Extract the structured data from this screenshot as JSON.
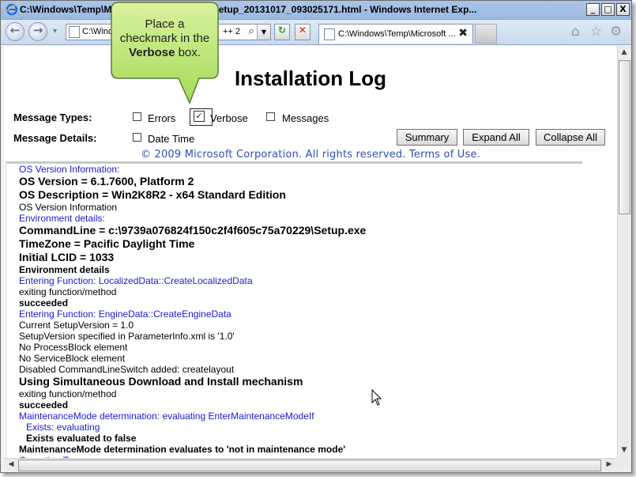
{
  "window": {
    "title": "C:\\Windows\\Temp\\M... x86 Redistributable Setup_20131017_093025171.html - Windows Internet Exp...",
    "minimize": "_",
    "maximize": "□",
    "close": "X"
  },
  "toolbar": {
    "back": "←",
    "forward": "→",
    "dropdown": "▾",
    "address": "C:\\Windo",
    "address_tail": "++ 2",
    "search_glyph": "⌕",
    "refresh": "↻",
    "stop": "✕",
    "tab_label": "C:\\Windows\\Temp\\Microsoft ...",
    "tab_close": "✖",
    "home": "⌂",
    "favorites": "☆",
    "tools": "⚙"
  },
  "callout": {
    "line1": "Place a",
    "line2": "checkmark in the",
    "bold": "Verbose",
    "line3_tail": " box."
  },
  "page": {
    "title": "Installation Log",
    "message_types_label": "Message Types:",
    "message_details_label": "Message Details:",
    "options": {
      "errors": "Errors",
      "verbose": "Verbose",
      "messages": "Messages",
      "date_time": "Date Time"
    },
    "verbose_checked": true,
    "buttons": {
      "summary": "Summary",
      "expand_all": "Expand All",
      "collapse_all": "Collapse All"
    },
    "copyright": "© 2009 Microsoft Corporation. All rights reserved. Terms of Use."
  },
  "log": [
    {
      "text": "OS Version Information:",
      "style": "s blue"
    },
    {
      "text": "OS Version = 6.1.7600, Platform 2",
      "style": "l"
    },
    {
      "text": "OS Description = Win2K8R2 - x64 Standard Edition",
      "style": "l"
    },
    {
      "text": "OS Version Information",
      "style": "s"
    },
    {
      "text": "Environment details:",
      "style": "s blue"
    },
    {
      "text": "CommandLine = c:\\9739a076824f150c2f4f605c75a70229\\Setup.exe",
      "style": "l"
    },
    {
      "text": "TimeZone = Pacific Daylight Time",
      "style": "l"
    },
    {
      "text": "Initial LCID = 1033",
      "style": "l"
    },
    {
      "text": "Environment details",
      "style": "m"
    },
    {
      "text": "Entering Function: LocalizedData::CreateLocalizedData",
      "style": "s blue"
    },
    {
      "text": "exiting function/method",
      "style": "s"
    },
    {
      "text": "succeeded",
      "style": "m"
    },
    {
      "text": "Entering Function: EngineData::CreateEngineData",
      "style": "s blue"
    },
    {
      "text": "Current SetupVersion = 1.0",
      "style": "s"
    },
    {
      "text": "SetupVersion specified in ParameterInfo.xml is '1.0'",
      "style": "s"
    },
    {
      "text": "No ProcessBlock element",
      "style": "s"
    },
    {
      "text": "No ServiceBlock element",
      "style": "s"
    },
    {
      "text": "Disabled CommandLineSwitch added: createlayout",
      "style": "s"
    },
    {
      "text": "Using Simultaneous Download and Install mechanism",
      "style": "l"
    },
    {
      "text": "exiting function/method",
      "style": "s"
    },
    {
      "text": "succeeded",
      "style": "m"
    },
    {
      "text": "MaintenanceMode determination: evaluating EnterMaintenanceModeIf",
      "style": "s blue"
    },
    {
      "text": "Exists: evaluating",
      "style": "s blue indent"
    },
    {
      "text": "Exists evaluated to false",
      "style": "m indent"
    },
    {
      "text": "MaintenanceMode determination evaluates to 'not in maintenance mode'",
      "style": "m"
    },
    {
      "text": "Operation Type:",
      "style": "s blue"
    }
  ],
  "colors": {
    "link_blue": "#1a1ad0",
    "callout_green": "#b5e36a",
    "title_bar": "#a9c5e8"
  }
}
